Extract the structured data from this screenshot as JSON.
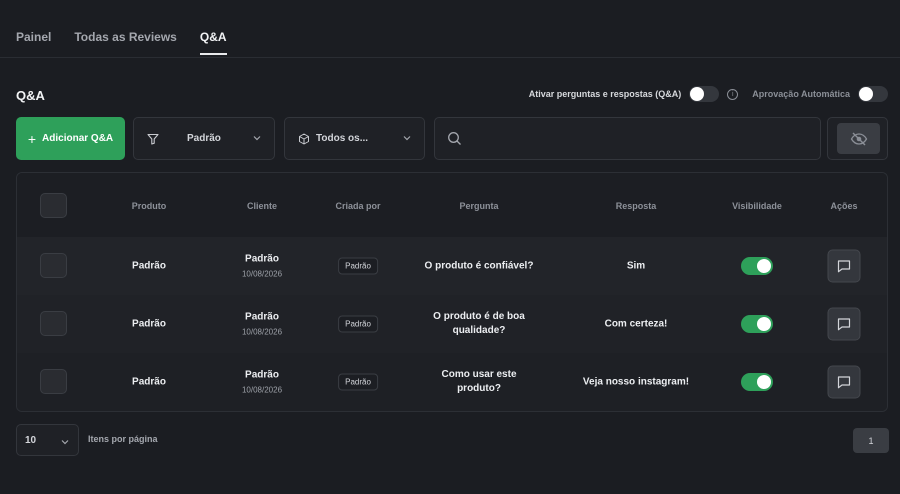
{
  "tabs": [
    {
      "label": "Painel",
      "active": false
    },
    {
      "label": "Todas as Reviews",
      "active": false
    },
    {
      "label": "Q&A",
      "active": true
    }
  ],
  "section_title": "Q&A",
  "toggles": {
    "enable_qa_label": "Ativar perguntas e respostas (Q&A)",
    "enable_qa_on": false,
    "info_icon": "info-icon",
    "auto_approval_label": "Aprovação Automática",
    "auto_approval_on": false
  },
  "toolbar": {
    "add_label": "Adicionar Q&A",
    "filter_value": "Padrão",
    "products_value": "Todos os...",
    "search_placeholder": "",
    "visibility_icon": "eye-off-icon"
  },
  "table": {
    "headers": [
      "Produto",
      "Cliente",
      "Criada por",
      "Pergunta",
      "Resposta",
      "Visibilidade",
      "Ações"
    ],
    "rows": [
      {
        "produto": "Padrão",
        "cliente": "Padrão",
        "data": "10/08/2026",
        "criada_por": "Padrão",
        "pergunta": "O produto é confiável?",
        "resposta": "Sim",
        "visivel": true
      },
      {
        "produto": "Padrão",
        "cliente": "Padrão",
        "data": "10/08/2026",
        "criada_por": "Padrão",
        "pergunta": "O produto é de boa qualidade?",
        "resposta": "Com certeza!",
        "visivel": true
      },
      {
        "produto": "Padrão",
        "cliente": "Padrão",
        "data": "10/08/2026",
        "criada_por": "Padrão",
        "pergunta": "Como usar este produto?",
        "resposta": "Veja nosso instagram!",
        "visivel": true
      }
    ]
  },
  "footer": {
    "page_size": "10",
    "per_page_label": "Itens por página",
    "current_page": "1"
  },
  "colors": {
    "accent_green": "#2ea05a",
    "background": "#1b1d22"
  }
}
